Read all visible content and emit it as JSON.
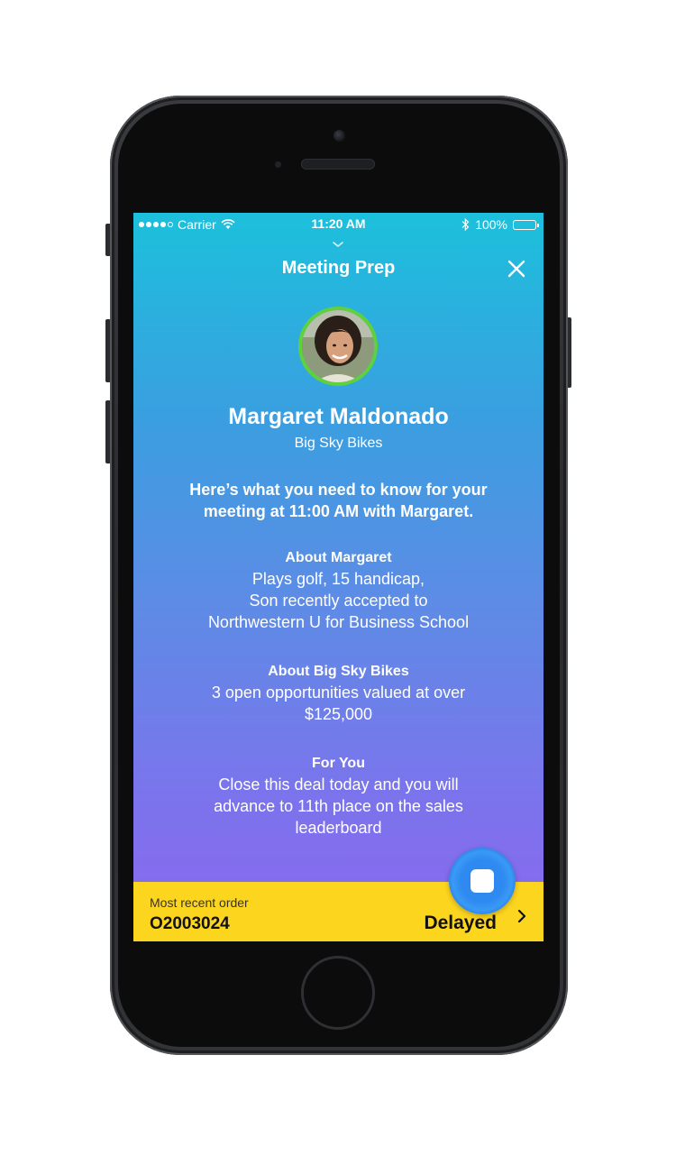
{
  "status_bar": {
    "carrier": "Carrier",
    "time": "11:20 AM",
    "battery": "100%"
  },
  "nav": {
    "title": "Meeting Prep"
  },
  "contact": {
    "name": "Margaret Maldonado",
    "company": "Big Sky Bikes"
  },
  "intro": "Here’s what you need to know for your meeting at 11:00 AM with Margaret.",
  "sections": [
    {
      "heading": "About Margaret",
      "lines": [
        "Plays golf, 15 handicap,",
        "Son recently accepted to",
        "Northwestern U for Business School"
      ]
    },
    {
      "heading": "About Big Sky Bikes",
      "lines": [
        "3 open opportunities valued at over",
        "$125,000"
      ]
    },
    {
      "heading": "For You",
      "lines": [
        "Close this deal today and you will",
        "advance to 11th place on the sales",
        "leaderboard"
      ]
    }
  ],
  "order": {
    "label": "Most recent order",
    "id": "O2003024",
    "status": "Delayed"
  },
  "colors": {
    "gradient_top": "#1cc0dc",
    "gradient_bottom": "#8b67ef",
    "order_bar": "#fcd51f",
    "avatar_ring": "#5fd13c",
    "fab": "#2e8af0"
  }
}
